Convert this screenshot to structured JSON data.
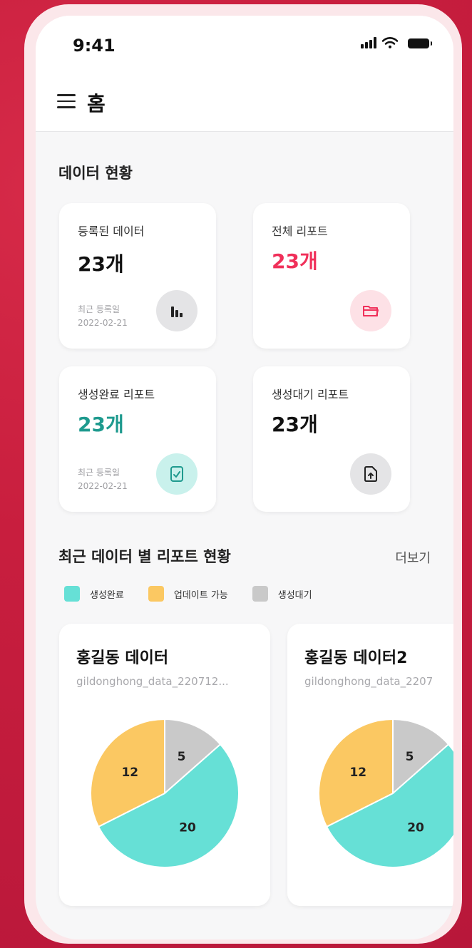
{
  "status": {
    "time": "9:41"
  },
  "appbar": {
    "title": "홈"
  },
  "overview": {
    "title": "데이터 현황",
    "cards": [
      {
        "label": "등록된 데이터",
        "value": "23개",
        "sub_label": "최근 등록일",
        "sub_date": "2022-02-21",
        "icon": "bar-chart-icon"
      },
      {
        "label": "전체 리포트",
        "value": "23개",
        "icon": "folder-icon"
      },
      {
        "label": "생성완료 리포트",
        "value": "23개",
        "sub_label": "최근 등록일",
        "sub_date": "2022-02-21",
        "icon": "document-check-icon"
      },
      {
        "label": "생성대기 리포트",
        "value": "23개",
        "icon": "upload-file-icon"
      }
    ]
  },
  "reports": {
    "title": "최근 데이터 별 리포트 현황",
    "more": "더보기",
    "legend": [
      {
        "label": "생성완료",
        "color": "#66e0d6"
      },
      {
        "label": "업데이트 가능",
        "color": "#fbc862"
      },
      {
        "label": "생성대기",
        "color": "#c9c9c9"
      }
    ],
    "items": [
      {
        "title": "홍길동 데이터",
        "filename": "gildonghong_data_220712..."
      },
      {
        "title": "홍길동 데이터2",
        "filename": "gildonghong_data_2207"
      }
    ]
  },
  "colors": {
    "accent_red": "#f0305a",
    "accent_teal": "#1e9a8e"
  },
  "chart_data": [
    {
      "type": "pie",
      "categories": [
        "생성완료",
        "업데이트 가능",
        "생성대기"
      ],
      "values": [
        20,
        12,
        5
      ]
    },
    {
      "type": "pie",
      "categories": [
        "생성완료",
        "업데이트 가능",
        "생성대기"
      ],
      "values": [
        20,
        12,
        5
      ]
    }
  ]
}
